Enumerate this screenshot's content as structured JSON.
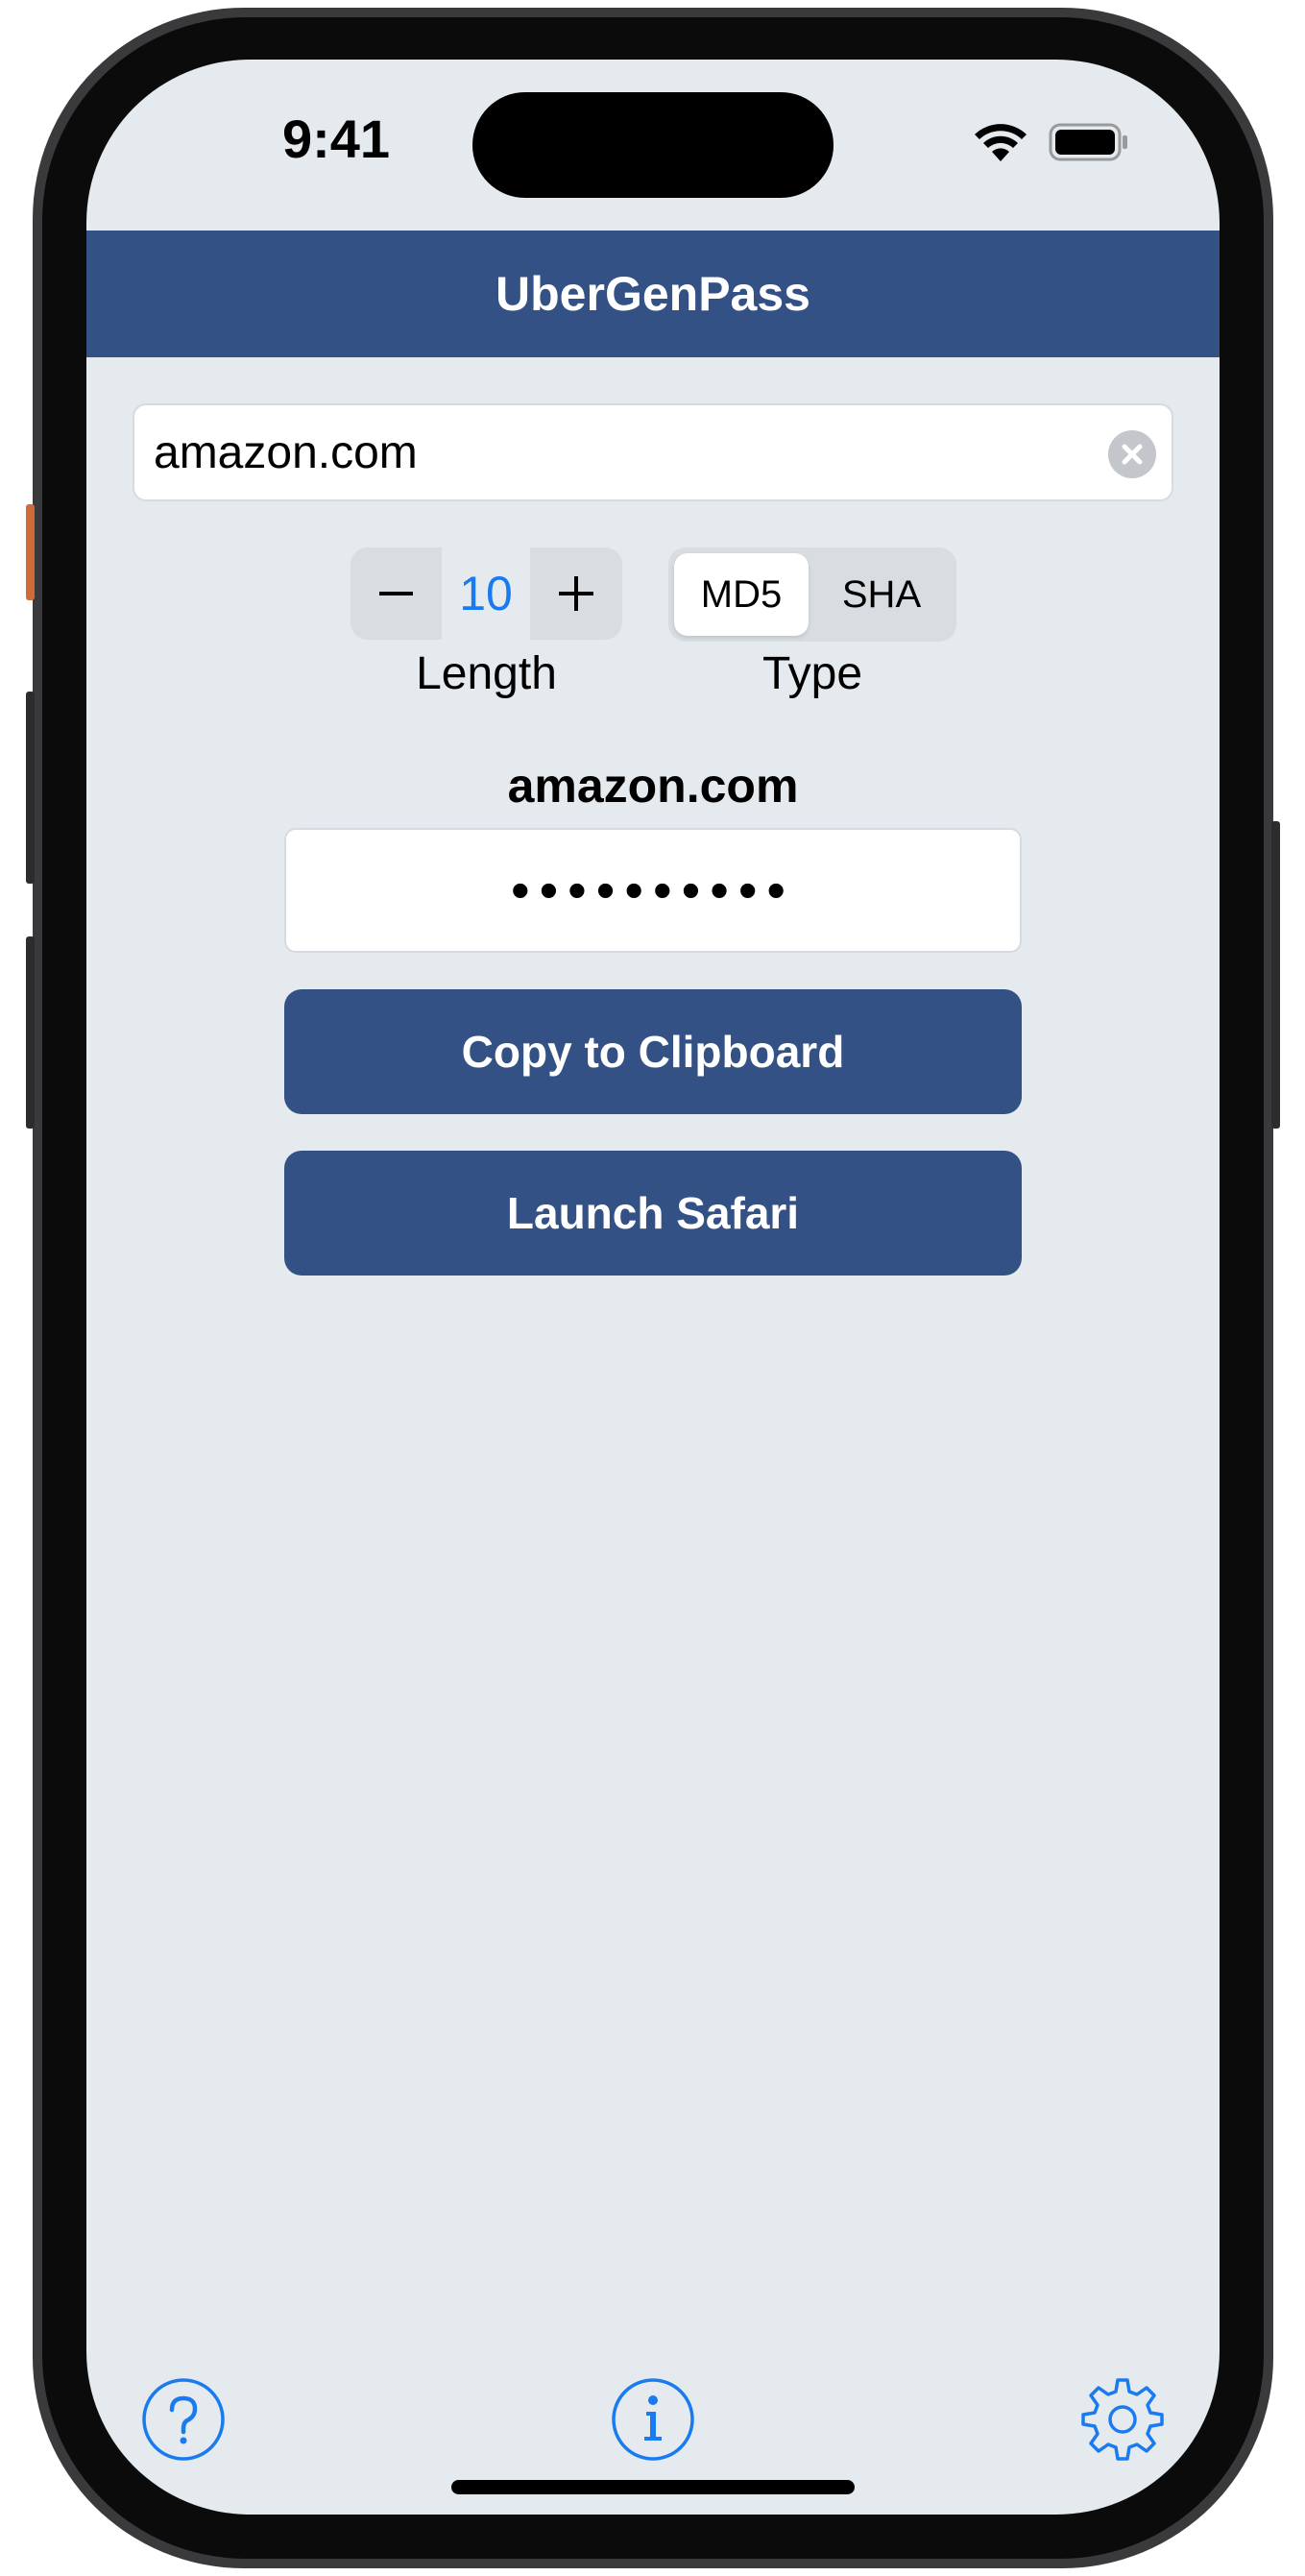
{
  "status_bar": {
    "time": "9:41",
    "icons": [
      "wifi-icon",
      "battery-icon"
    ]
  },
  "navbar": {
    "title": "UberGenPass"
  },
  "url_field": {
    "value": "amazon.com",
    "clear_icon": "clear-icon"
  },
  "length_stepper": {
    "minus_symbol": "−",
    "value": "10",
    "plus_symbol": "+",
    "label": "Length"
  },
  "type_selector": {
    "options": [
      "MD5",
      "SHA"
    ],
    "selected": "MD5",
    "label": "Type"
  },
  "result": {
    "domain": "amazon.com",
    "password_masked": "••••••••••"
  },
  "buttons": {
    "copy_label": "Copy to Clipboard",
    "safari_label": "Launch Safari"
  },
  "toolbar": {
    "help_icon": "question-mark-icon",
    "info_icon": "info-icon",
    "settings_icon": "gear-icon"
  },
  "colors": {
    "accent": "#345186",
    "link": "#1a7af0",
    "background": "#e4eaed"
  }
}
